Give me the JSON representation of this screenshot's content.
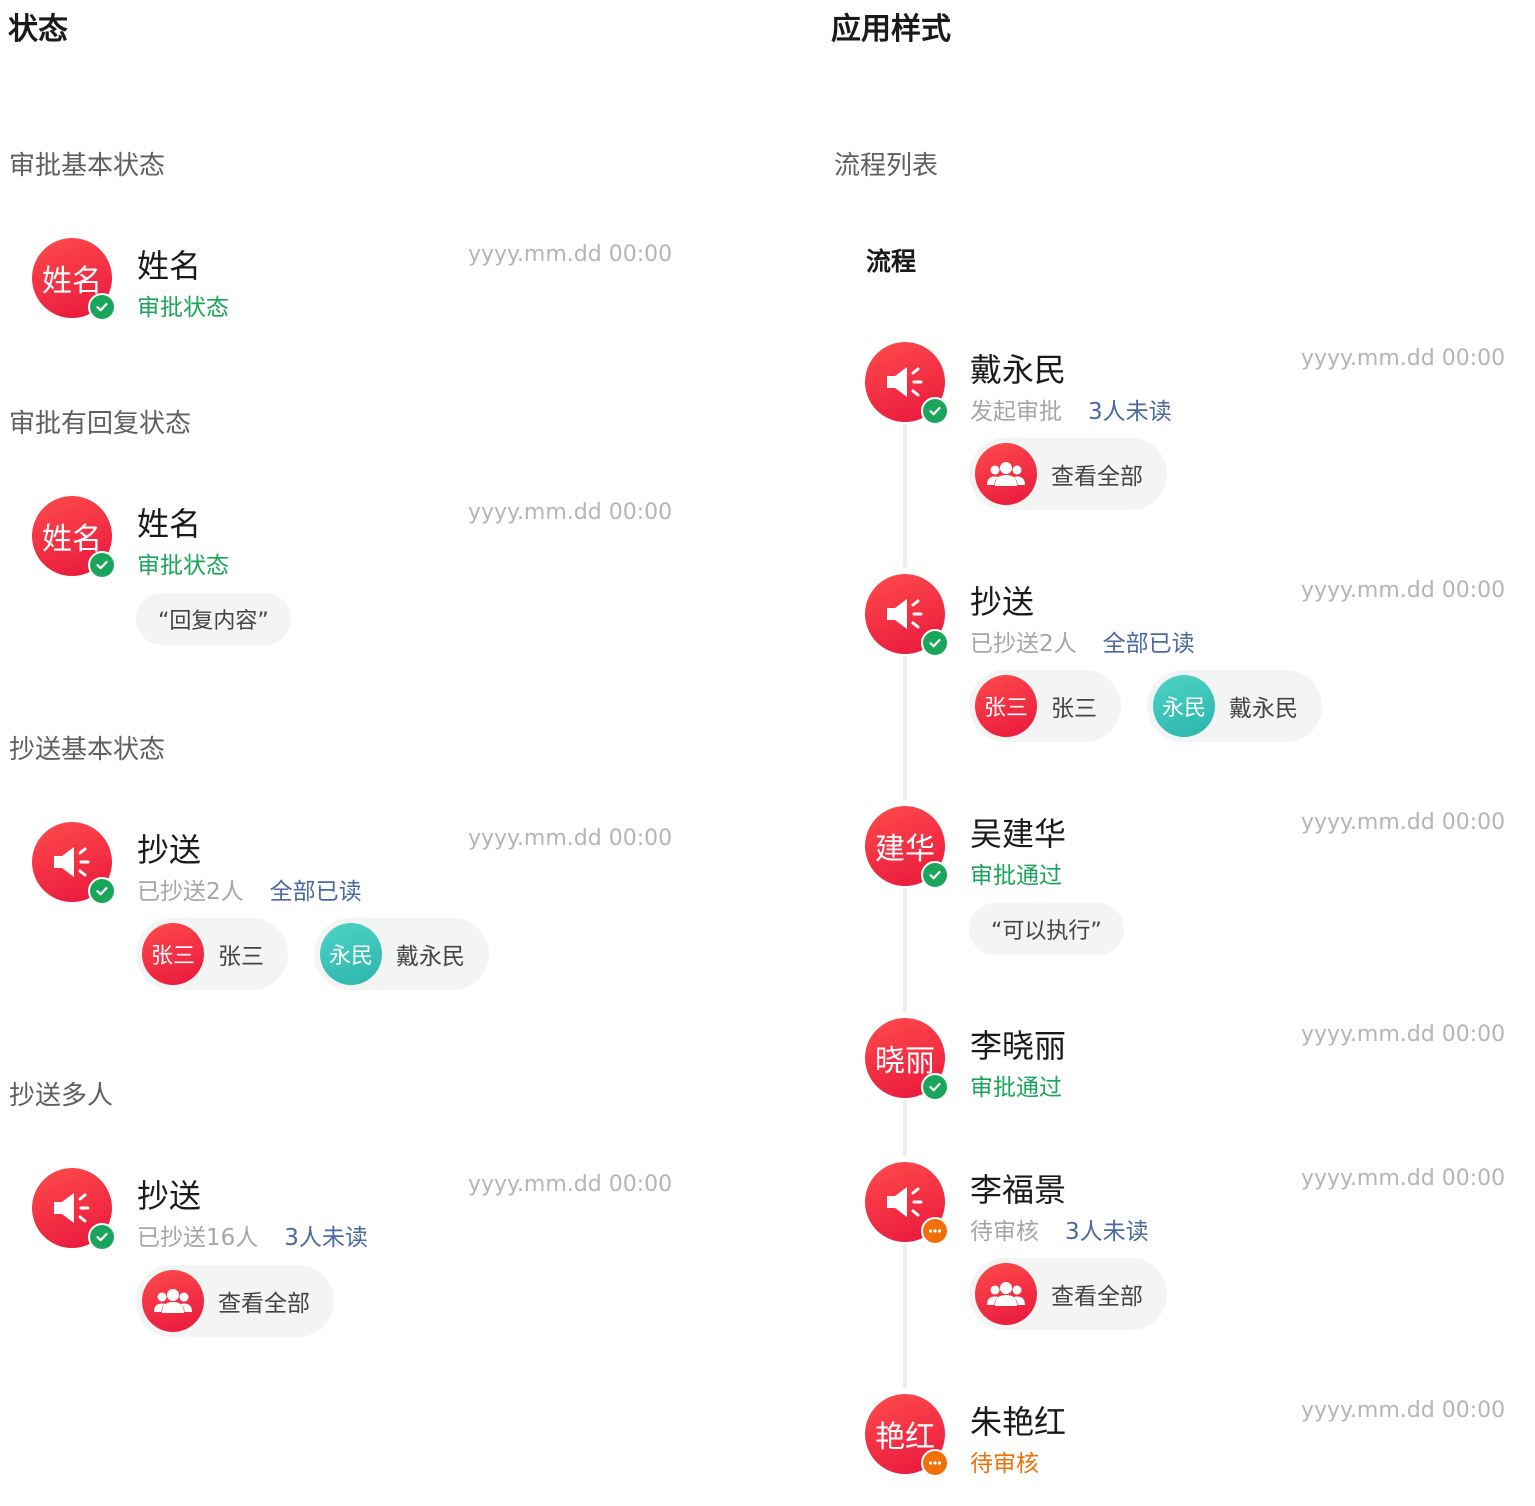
{
  "left": {
    "heading": "状态",
    "sections": [
      {
        "label": "审批基本状态"
      },
      {
        "label": "审批有回复状态"
      },
      {
        "label": "抄送基本状态"
      },
      {
        "label": "抄送多人"
      }
    ],
    "card1": {
      "avatar": "姓名",
      "name": "姓名",
      "time": "yyyy.mm.dd 00:00",
      "status": "审批状态"
    },
    "card2": {
      "avatar": "姓名",
      "name": "姓名",
      "time": "yyyy.mm.dd 00:00",
      "status": "审批状态",
      "reply": "“回复内容”"
    },
    "card3": {
      "name": "抄送",
      "time": "yyyy.mm.dd 00:00",
      "status": "已抄送2人",
      "read": "全部已读",
      "people": [
        {
          "avatar": "张三",
          "name": "张三"
        },
        {
          "avatar": "永民",
          "name": "戴永民"
        }
      ]
    },
    "card4": {
      "name": "抄送",
      "time": "yyyy.mm.dd 00:00",
      "status": "已抄送16人",
      "read": "3人未读",
      "view_all": "查看全部"
    }
  },
  "right": {
    "heading": "应用样式",
    "section_label": "流程列表",
    "flow_title": "流程",
    "items": [
      {
        "name": "戴永民",
        "time": "yyyy.mm.dd 00:00",
        "status": "发起审批",
        "read": "3人未读",
        "view_all": "查看全部"
      },
      {
        "name": "抄送",
        "time": "yyyy.mm.dd 00:00",
        "status": "已抄送2人",
        "read": "全部已读",
        "people": [
          {
            "avatar": "张三",
            "name": "张三"
          },
          {
            "avatar": "永民",
            "name": "戴永民"
          }
        ]
      },
      {
        "avatar": "建华",
        "name": "吴建华",
        "time": "yyyy.mm.dd 00:00",
        "status": "审批通过",
        "reply": "“可以执行”"
      },
      {
        "avatar": "晓丽",
        "name": "李晓丽",
        "time": "yyyy.mm.dd 00:00",
        "status": "审批通过"
      },
      {
        "name": "李福景",
        "time": "yyyy.mm.dd 00:00",
        "status": "待审核",
        "read": "3人未读",
        "view_all": "查看全部"
      },
      {
        "avatar": "艳红",
        "name": "朱艳红",
        "time": "yyyy.mm.dd 00:00",
        "status": "待审核"
      }
    ]
  },
  "colors": {
    "brand_red": "#ee2247",
    "approved_green": "#1aa65a",
    "pending_orange": "#f0700a",
    "link_blue": "#4a6aa0",
    "teal": "#2bb5ad"
  },
  "icons": {
    "approved": "check-badge-icon",
    "pending": "ellipsis-badge-icon",
    "cc": "megaphone-icon",
    "group": "group-icon"
  }
}
